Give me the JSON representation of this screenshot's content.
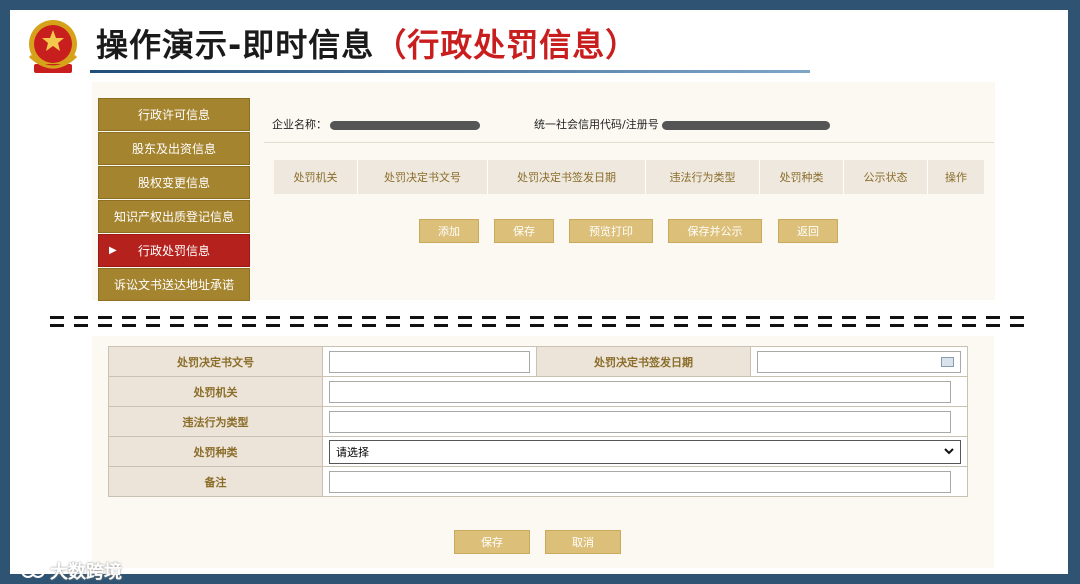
{
  "title": {
    "main": "操作演示-即时信息",
    "sub": "（行政处罚信息）"
  },
  "sidebar": {
    "items": [
      {
        "label": "行政许可信息"
      },
      {
        "label": "股东及出资信息"
      },
      {
        "label": "股权变更信息"
      },
      {
        "label": "知识产权出质登记信息"
      },
      {
        "label": "行政处罚信息",
        "active": true,
        "marker": "▶"
      },
      {
        "label": "诉讼文书送达地址承诺"
      }
    ]
  },
  "company": {
    "name_label": "企业名称：",
    "code_label": "统一社会信用代码/注册号"
  },
  "penalty_table": {
    "headers": [
      "处罚机关",
      "处罚决定书文号",
      "处罚决定书签发日期",
      "违法行为类型",
      "处罚种类",
      "公示状态",
      "操作"
    ]
  },
  "actions": {
    "add": "添加",
    "save": "保存",
    "preview_print": "预览打印",
    "save_publish": "保存并公示",
    "back": "返回"
  },
  "form": {
    "doc_no_label": "处罚决定书文号",
    "date_label": "处罚决定书签发日期",
    "authority_label": "处罚机关",
    "violation_label": "违法行为类型",
    "category_label": "处罚种类",
    "category_selected": "请选择",
    "remark_label": "备注",
    "save": "保存",
    "cancel": "取消"
  },
  "watermark": "大数跨境",
  "colors": {
    "brand_gold": "#a5842f",
    "active_red": "#b5211c",
    "title_red": "#c81e1e",
    "button_gold": "#dcc07a"
  }
}
